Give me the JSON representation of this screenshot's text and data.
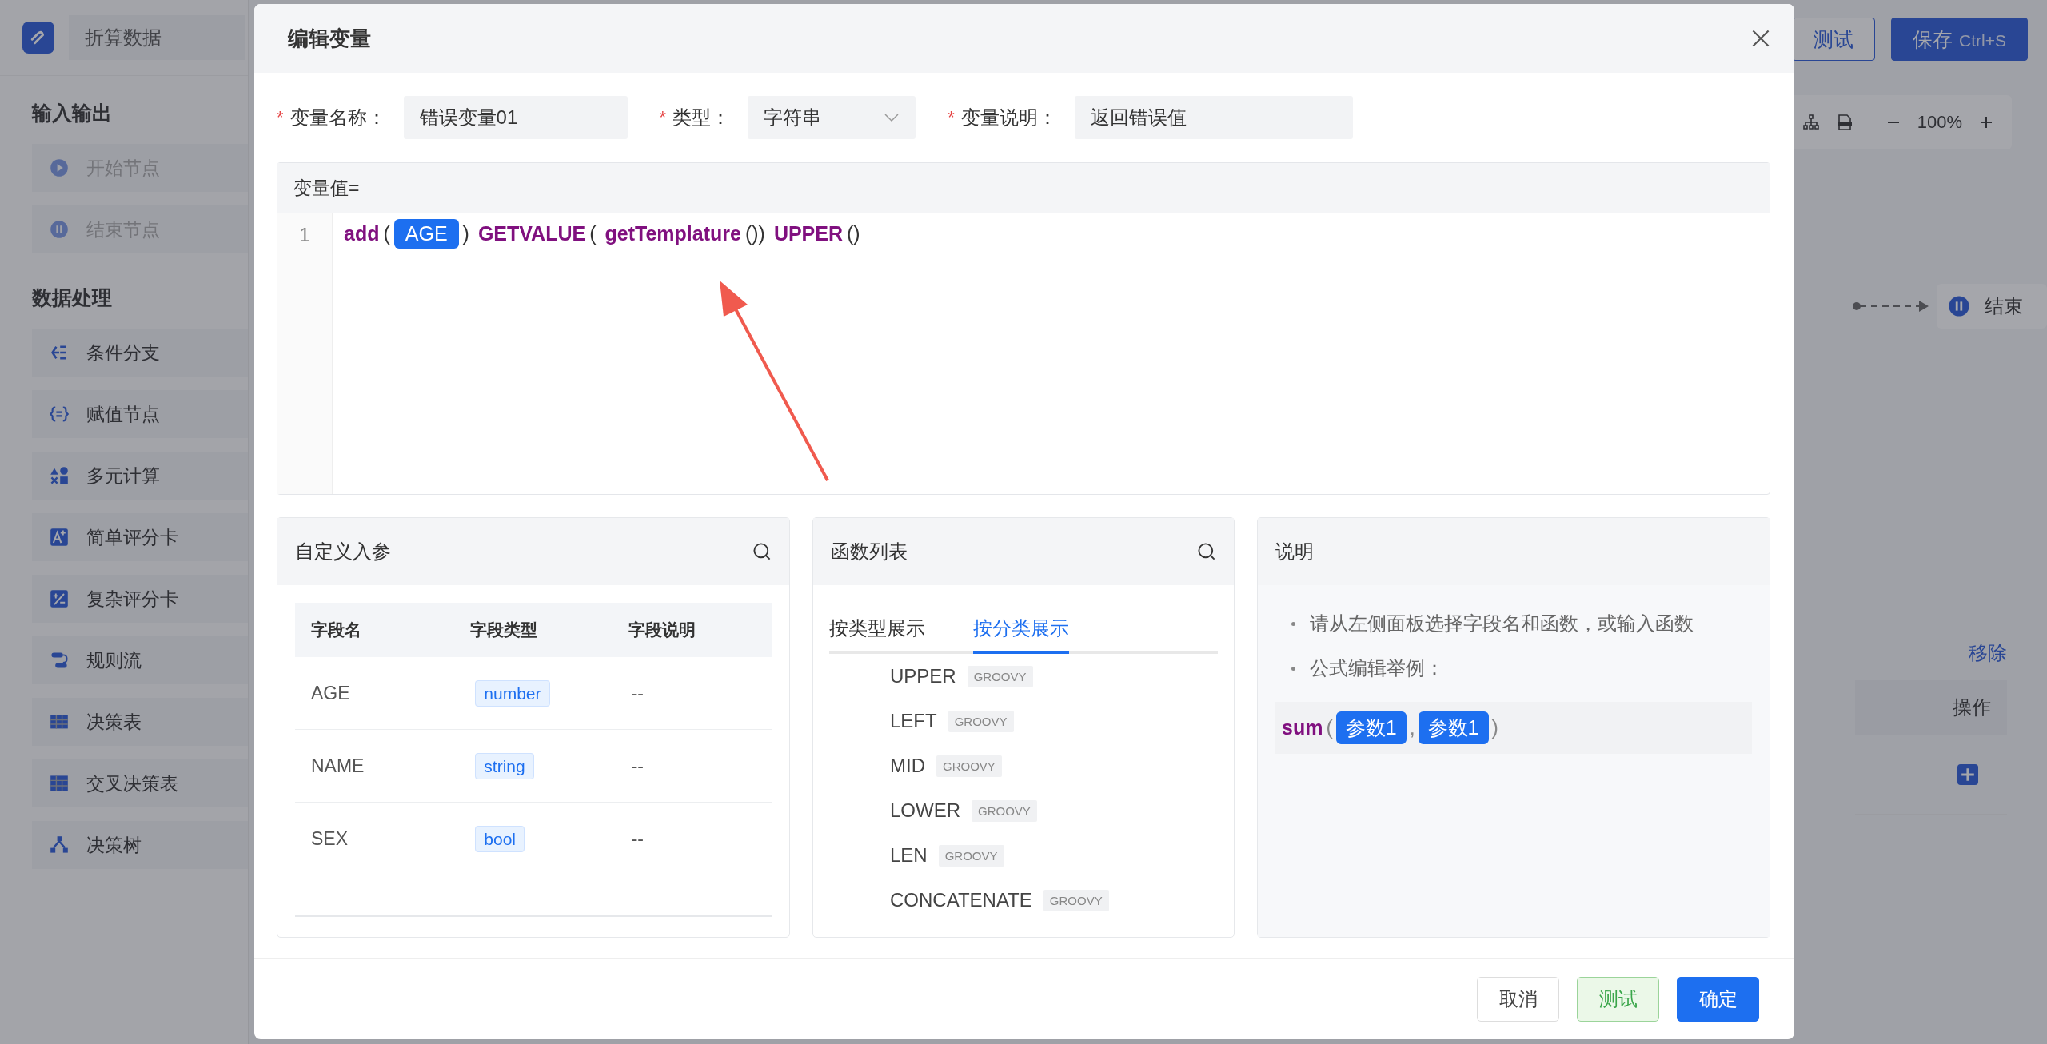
{
  "app": {
    "title": "折算数据",
    "header_buttons": [
      {
        "label": "测试",
        "kind": "outline"
      },
      {
        "label": "保存",
        "shortcut": "Ctrl+S",
        "kind": "primary"
      }
    ],
    "sidebar": {
      "sections": [
        {
          "title": "输入输出",
          "items": [
            {
              "label": "开始节点",
              "disabled": true
            },
            {
              "label": "结束节点",
              "disabled": true
            }
          ]
        },
        {
          "title": "数据处理",
          "items": [
            {
              "label": "条件分支",
              "disabled": false
            },
            {
              "label": "赋值节点",
              "disabled": false
            },
            {
              "label": "多元计算",
              "disabled": false
            },
            {
              "label": "简单评分卡",
              "disabled": false
            },
            {
              "label": "复杂评分卡",
              "disabled": false
            },
            {
              "label": "规则流",
              "disabled": false
            },
            {
              "label": "决策表",
              "disabled": false
            },
            {
              "label": "交叉决策表",
              "disabled": false
            },
            {
              "label": "决策树",
              "disabled": false
            }
          ]
        }
      ]
    },
    "toolbar": {
      "zoom": "100%"
    },
    "canvas": {
      "node": "结束"
    },
    "bottom_panel": {
      "link": "移除",
      "column": "操作"
    }
  },
  "modal": {
    "title": "编辑变量",
    "fields": [
      {
        "mark": "*",
        "label": "变量名称：",
        "value": "错误变量01",
        "kind": "input"
      },
      {
        "mark": "*",
        "label": "类型：",
        "value": "字符串",
        "kind": "select"
      },
      {
        "mark": "*",
        "label": "变量说明：",
        "value": "返回错误值",
        "kind": "input"
      }
    ],
    "editor": {
      "label": "变量值=",
      "lines": [
        {
          "number": "1",
          "tokens": [
            {
              "kind": "fn",
              "text": "add"
            },
            {
              "kind": "punct",
              "text": "("
            },
            {
              "kind": "var",
              "text": "AGE"
            },
            {
              "kind": "punct",
              "text": ")"
            },
            {
              "kind": "fn",
              "text": "GETVALUE"
            },
            {
              "kind": "punct",
              "text": "("
            },
            {
              "kind": "fn",
              "text": "getTemplature"
            },
            {
              "kind": "punct",
              "text": "())"
            },
            {
              "kind": "fn",
              "text": "UPPER"
            },
            {
              "kind": "punct",
              "text": "()"
            }
          ]
        }
      ]
    },
    "params": {
      "title": "自定义入参",
      "columns": [
        "字段名",
        "字段类型",
        "字段说明"
      ],
      "rows": [
        {
          "name": "AGE",
          "type": "number",
          "desc": "--"
        },
        {
          "name": "NAME",
          "type": "string",
          "desc": "--"
        },
        {
          "name": "SEX",
          "type": "bool",
          "desc": "--"
        }
      ]
    },
    "functions": {
      "title": "函数列表",
      "tabs": [
        {
          "label": "按类型展示",
          "selected": false
        },
        {
          "label": "按分类展示",
          "selected": true
        }
      ],
      "items": [
        {
          "name": "UPPER",
          "tag": "GROOVY"
        },
        {
          "name": "LEFT",
          "tag": "GROOVY"
        },
        {
          "name": "MID",
          "tag": "GROOVY"
        },
        {
          "name": "LOWER",
          "tag": "GROOVY"
        },
        {
          "name": "LEN",
          "tag": "GROOVY"
        },
        {
          "name": "CONCATENATE",
          "tag": "GROOVY"
        }
      ]
    },
    "help": {
      "title": "说明",
      "bullets": [
        "请从左侧面板选择字段名和函数，或输入函数",
        "公式编辑举例："
      ],
      "example": [
        {
          "kind": "fn",
          "text": "sum"
        },
        {
          "kind": "punct",
          "text": "("
        },
        {
          "kind": "var",
          "text": "参数1"
        },
        {
          "kind": "punct",
          "text": ","
        },
        {
          "kind": "var",
          "text": "参数1"
        },
        {
          "kind": "punct",
          "text": ")"
        }
      ]
    },
    "buttons": [
      {
        "label": "取消",
        "kind": "default"
      },
      {
        "label": "测试",
        "kind": "success"
      },
      {
        "label": "确定",
        "kind": "primary"
      }
    ]
  }
}
